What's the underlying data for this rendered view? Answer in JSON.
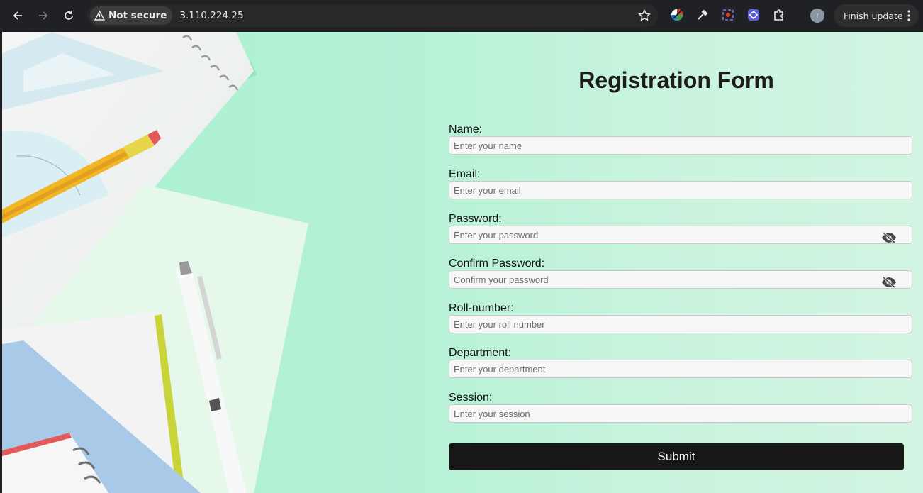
{
  "browser": {
    "security_label": "Not secure",
    "url": "3.110.224.25",
    "profile_initial": "r",
    "update_label": "Finish update"
  },
  "form": {
    "title": "Registration Form",
    "fields": [
      {
        "label": "Name:",
        "placeholder": "Enter your name"
      },
      {
        "label": "Email:",
        "placeholder": "Enter your email"
      },
      {
        "label": "Password:",
        "placeholder": "Enter your password"
      },
      {
        "label": "Confirm Password:",
        "placeholder": "Confirm your password"
      },
      {
        "label": "Roll-number:",
        "placeholder": "Enter your roll number"
      },
      {
        "label": "Department:",
        "placeholder": "Enter your department"
      },
      {
        "label": "Session:",
        "placeholder": "Enter your session"
      }
    ],
    "submit_label": "Submit"
  },
  "colors": {
    "page_background": "#b6f1d6",
    "button": "#171717",
    "chrome": "#202124"
  }
}
